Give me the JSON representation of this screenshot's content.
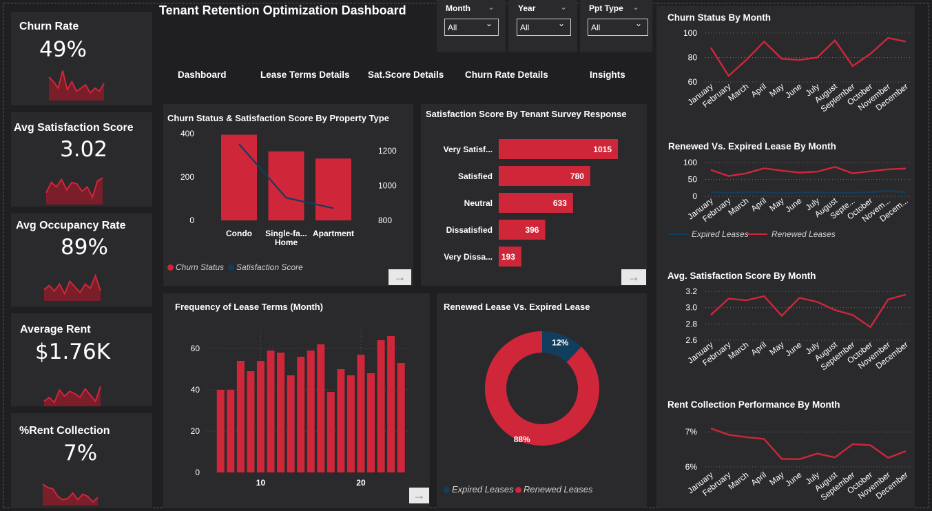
{
  "colors": {
    "red": "#d0263a",
    "navy": "#123e5e",
    "background": "#1f1f22",
    "panel": "#2a2a2d"
  },
  "title": "Tenant Retention Optimization Dashboard",
  "slicers": [
    {
      "label": "Month",
      "value": "All"
    },
    {
      "label": "Year",
      "value": "All"
    },
    {
      "label": "Ppt Type",
      "value": "All"
    }
  ],
  "nav": [
    "Dashboard",
    "Lease Terms Details",
    "Sat.Score Details",
    "Churn Rate Details",
    "Insights"
  ],
  "kpis": [
    {
      "title": "Churn Rate",
      "value": "49%",
      "spark": [
        0.7,
        0.55,
        0.35,
        0.9,
        0.3,
        0.55,
        0.25,
        0.35,
        0.45,
        0.2,
        0.35,
        0.25,
        0.5
      ]
    },
    {
      "title": "Avg Satisfaction Score",
      "value": "3.02",
      "spark": [
        0.35,
        0.7,
        0.55,
        0.8,
        0.45,
        0.7,
        0.65,
        0.4,
        0.55,
        0.2,
        0.75,
        0.85
      ]
    },
    {
      "title": "Avg Occupancy Rate",
      "value": "89%",
      "spark": [
        0.35,
        0.5,
        0.3,
        0.55,
        0.2,
        0.65,
        0.45,
        0.25,
        0.55,
        0.4,
        0.85,
        0.3
      ]
    },
    {
      "title": "Average Rent",
      "value": "$1.76K",
      "spark": [
        0.15,
        0.3,
        0.1,
        0.6,
        0.35,
        0.55,
        0.45,
        0.3,
        0.65,
        0.4,
        0.15,
        0.75
      ]
    },
    {
      "title": "%Rent Collection",
      "value": "7%",
      "spark": [
        0.9,
        0.75,
        0.7,
        0.35,
        0.2,
        0.25,
        0.5,
        0.2,
        0.45,
        0.35,
        0.1,
        0.3
      ]
    }
  ],
  "chart_data": [
    {
      "type": "bar",
      "title": "Churn Status & Satisfaction Score By Property Type",
      "categories": [
        "Condo",
        "Single-fa... Home",
        "Apartment"
      ],
      "category_lines": [
        [
          "Condo"
        ],
        [
          "Single-fa...",
          "Home"
        ],
        [
          "Apartment"
        ]
      ],
      "series": [
        {
          "name": "Churn Status",
          "type": "bar",
          "values": [
            395,
            318,
            285
          ]
        },
        {
          "name": "Satisfaction Score",
          "type": "line",
          "values": [
            1240,
            930,
            870
          ]
        }
      ],
      "ylim": [
        0,
        400
      ],
      "y_ticks": [
        "0",
        "200",
        "400"
      ],
      "y2lim": [
        800,
        1300
      ],
      "y2_ticks": [
        "800",
        "1000",
        "1200"
      ],
      "legend": "bottom"
    },
    {
      "type": "bar",
      "orientation": "horizontal",
      "title": "Satisfaction Score By Tenant Survey Response",
      "categories": [
        "Very Satisf...",
        "Satisfied",
        "Neutral",
        "Dissatisfied",
        "Very Dissa..."
      ],
      "values": [
        1015,
        780,
        633,
        396,
        193
      ],
      "data_labels": [
        "1015",
        "780",
        "633",
        "396",
        "193"
      ]
    },
    {
      "type": "bar",
      "title": "Frequency of Lease Terms (Month)",
      "x": [
        6,
        7,
        8,
        9,
        10,
        11,
        12,
        13,
        14,
        15,
        16,
        17,
        18,
        19,
        20,
        21,
        22,
        23,
        24
      ],
      "values": [
        40,
        40,
        54,
        49,
        54,
        59,
        58,
        47,
        56,
        59,
        62,
        39,
        50,
        47,
        57,
        48,
        64,
        66,
        53
      ],
      "ylim": [
        0,
        70
      ],
      "y_ticks": [
        "0",
        "20",
        "40",
        "60"
      ],
      "x_ticks": [
        "10",
        "20"
      ]
    },
    {
      "type": "pie",
      "title": "Renewed Lease Vs. Expired Lease",
      "categories": [
        "Expired Leases",
        "Renewed Leases"
      ],
      "values": [
        12,
        88
      ],
      "data_labels": [
        "12%",
        "88%"
      ],
      "legend": "bottom"
    },
    {
      "type": "line",
      "title": "Churn Status By Month",
      "categories": [
        "January",
        "February",
        "March",
        "April",
        "May",
        "June",
        "July",
        "August",
        "September",
        "October",
        "November",
        "December"
      ],
      "values": [
        88,
        65,
        78,
        93,
        79,
        78,
        80,
        94,
        73,
        83,
        96,
        93
      ],
      "ylim": [
        60,
        100
      ],
      "y_ticks": [
        "60",
        "80",
        "100"
      ]
    },
    {
      "type": "line",
      "title": "Renewed Vs. Expired Lease By Month",
      "categories": [
        "January",
        "February",
        "March",
        "April",
        "May",
        "June",
        "July",
        "August",
        "Septe...",
        "October",
        "Novem...",
        "Decem..."
      ],
      "series": [
        {
          "name": "Expired Leases",
          "values": [
            12,
            10,
            12,
            11,
            9,
            11,
            11,
            10,
            10,
            12,
            16,
            12
          ]
        },
        {
          "name": "Renewed Leases",
          "values": [
            78,
            60,
            68,
            83,
            76,
            70,
            73,
            87,
            68,
            74,
            80,
            82
          ]
        }
      ],
      "ylim": [
        0,
        100
      ],
      "y_ticks": [
        "0",
        "50",
        "100"
      ],
      "legend": "bottom"
    },
    {
      "type": "line",
      "title": "Avg. Satisfaction Score By Month",
      "categories": [
        "January",
        "February",
        "March",
        "April",
        "May",
        "June",
        "July",
        "August",
        "September",
        "October",
        "November",
        "December"
      ],
      "values": [
        2.91,
        3.11,
        3.09,
        3.14,
        2.9,
        3.12,
        3.07,
        2.97,
        2.91,
        2.76,
        3.1,
        3.16
      ],
      "ylim": [
        2.6,
        3.2
      ],
      "y_ticks": [
        "2.6",
        "2.8",
        "3.0",
        "3.2"
      ]
    },
    {
      "type": "line",
      "title": "Rent Collection Performance By Month",
      "categories": [
        "January",
        "February",
        "March",
        "April",
        "May",
        "June",
        "July",
        "August",
        "September",
        "October",
        "November",
        "December"
      ],
      "values": [
        7.1,
        6.92,
        6.85,
        6.8,
        6.23,
        6.22,
        6.38,
        6.27,
        6.65,
        6.62,
        6.26,
        6.45
      ],
      "ylim": [
        5.9,
        7.3
      ],
      "y_ticks": [
        "6%",
        "7%"
      ],
      "y_tick_values": [
        6,
        7
      ]
    }
  ]
}
